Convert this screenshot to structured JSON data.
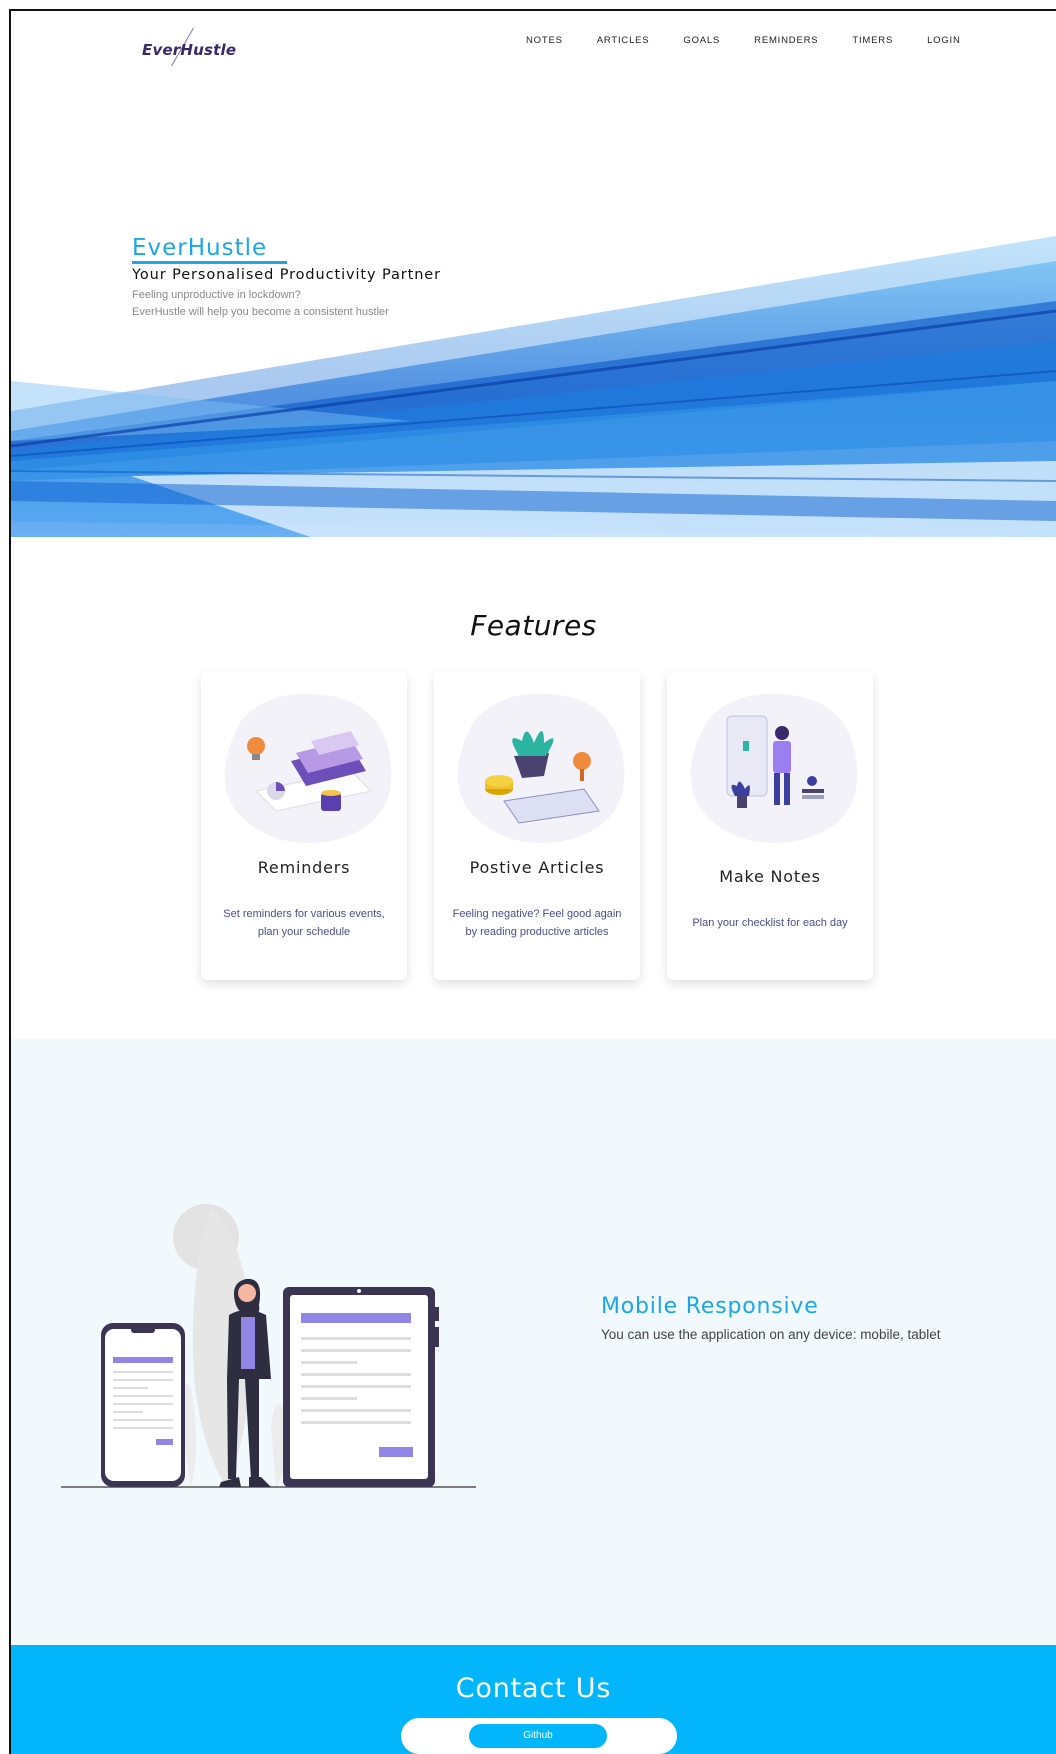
{
  "brand": {
    "logo_text": "EverHustle"
  },
  "nav": {
    "items": [
      {
        "label": "NOTES"
      },
      {
        "label": "ARTICLES"
      },
      {
        "label": "GOALS"
      },
      {
        "label": "REMINDERS"
      },
      {
        "label": "TIMERS"
      },
      {
        "label": "LOGIN"
      }
    ]
  },
  "hero": {
    "title": "EverHustle",
    "subtitle": "Your Personalised Productivity Partner",
    "line1": "Feeling unproductive in lockdown?",
    "line2": "EverHustle will help you become a consistent hustler"
  },
  "features": {
    "title": "Features",
    "cards": [
      {
        "title": "Reminders",
        "desc": "Set reminders for various events, plan your schedule",
        "illustration": "books-lightbulb-icon"
      },
      {
        "title": "Postive Articles",
        "desc": "Feeling negative? Feel good again by reading productive articles",
        "illustration": "plant-tablet-icon"
      },
      {
        "title": "Make Notes",
        "desc": "Plan your checklist for each day",
        "illustration": "person-screen-icon"
      }
    ]
  },
  "mobile": {
    "title": "Mobile Responsive",
    "desc": "You can use the application on any device: mobile, tablet"
  },
  "contact": {
    "title": "Contact Us",
    "github_label": "Github"
  },
  "colors": {
    "accent": "#1da6e8",
    "contact_bg": "#03b5fb",
    "mobile_bg": "#f1f9fd",
    "purple": "#9185e6"
  }
}
